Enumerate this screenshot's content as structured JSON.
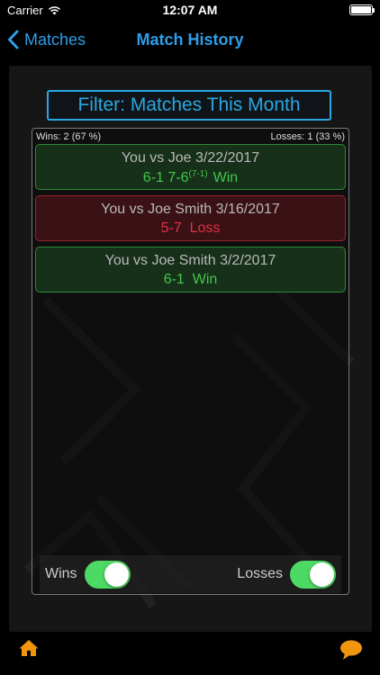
{
  "status_bar": {
    "carrier": "Carrier",
    "time": "12:07 AM"
  },
  "nav": {
    "back_label": "Matches",
    "title": "Match History"
  },
  "filter": {
    "label": "Filter: Matches This Month"
  },
  "stats": {
    "wins": "Wins: 2 (67 %)",
    "losses": "Losses: 1 (33 %)"
  },
  "matches": [
    {
      "result": "win",
      "title": "You vs Joe 3/22/2017",
      "score_a": "6-1 7-6",
      "tiebreak": "(7-1)",
      "outcome": "Win"
    },
    {
      "result": "loss",
      "title": "You vs Joe Smith 3/16/2017",
      "score_a": "5-7",
      "tiebreak": "",
      "outcome": "Loss"
    },
    {
      "result": "win",
      "title": "You vs Joe Smith 3/2/2017",
      "score_a": "6-1",
      "tiebreak": "",
      "outcome": "Win"
    }
  ],
  "toggles": {
    "wins": {
      "label": "Wins",
      "on": true
    },
    "losses": {
      "label": "Losses",
      "on": true
    }
  },
  "icons": {
    "home": "home-icon",
    "chat": "chat-bubble-icon",
    "back": "chevron-left-icon",
    "wifi": "wifi-icon",
    "battery": "battery-icon"
  },
  "colors": {
    "accent": "#2e9ee8",
    "win": "#43c64b",
    "loss": "#e23244",
    "toggle_on": "#4cd964",
    "icon_orange": "#f0950e"
  }
}
